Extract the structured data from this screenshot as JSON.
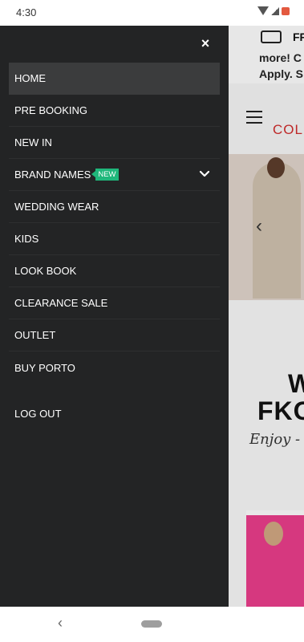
{
  "status_bar": {
    "time": "4:30"
  },
  "drawer": {
    "close_symbol": "×",
    "menu": [
      {
        "label": "HOME",
        "active": true
      },
      {
        "label": "PRE BOOKING"
      },
      {
        "label": "NEW IN"
      },
      {
        "label": "BRAND NAMES",
        "badge": "NEW",
        "has_submenu": true
      },
      {
        "label": "WEDDING WEAR"
      },
      {
        "label": "KIDS"
      },
      {
        "label": "LOOK BOOK"
      },
      {
        "label": "CLEARANCE SALE"
      },
      {
        "label": "OUTLET"
      },
      {
        "label": "BUY PORTO"
      }
    ],
    "logout_label": "LOG OUT"
  },
  "background_page": {
    "banner_text_1": "FR",
    "banner_text_2": "more! C",
    "banner_text_3": "Apply. S",
    "logo_text": "COL",
    "hero_arrow": "‹",
    "welcome_text": "W",
    "brand_text": "FKO",
    "tagline": "Enjoy -"
  },
  "nav_bar": {
    "back_symbol": "‹"
  },
  "colors": {
    "drawer_bg": "#232425",
    "active_item_bg": "#3b3c3d",
    "badge_bg": "#1fb77b"
  }
}
